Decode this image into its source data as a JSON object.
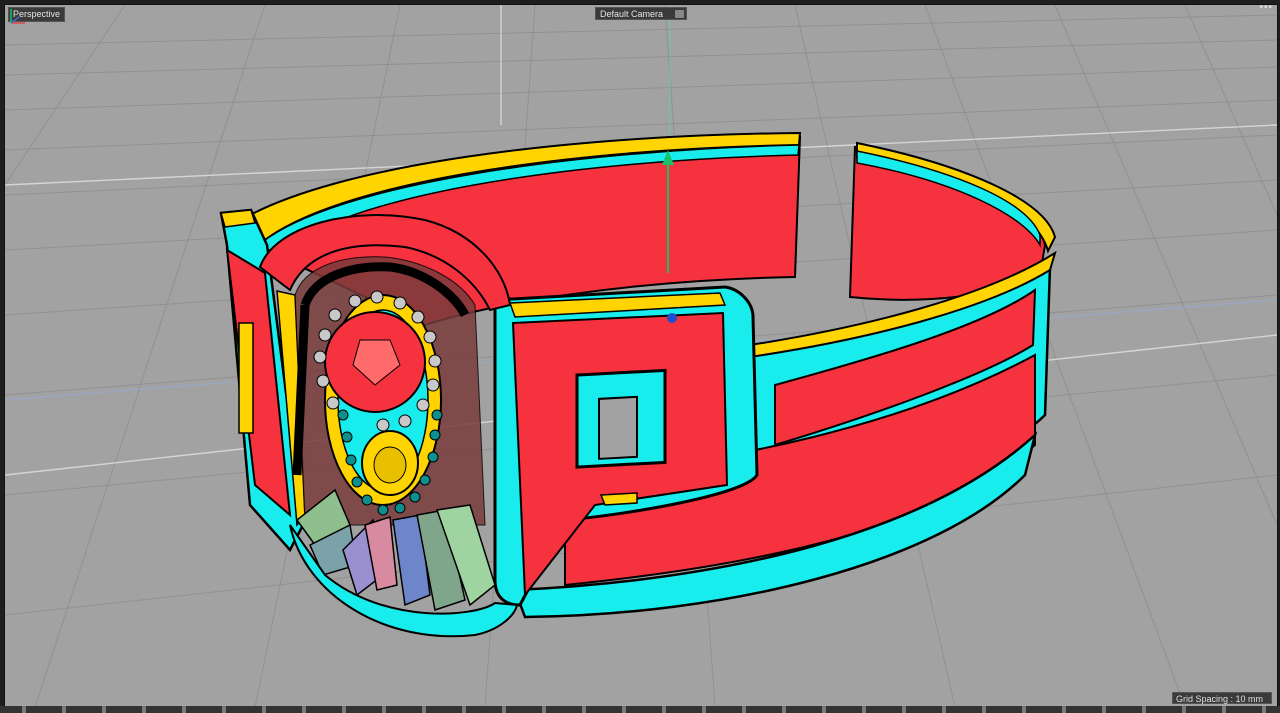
{
  "viewport": {
    "view_label": "Perspective",
    "camera_label": "Default Camera",
    "grid_spacing": "Grid Spacing : 10 mm",
    "menu_icon": "ellipsis-icon",
    "camera_icon": "camera-icon"
  },
  "colors": {
    "background": "#a2a2a2",
    "band_red": "#f7323f",
    "band_cyan": "#19ecec",
    "band_yellow": "#ffd400",
    "wire": "#000000",
    "gizmo_green": "#18c06a",
    "gizmo_blue": "#1d4dcc"
  }
}
